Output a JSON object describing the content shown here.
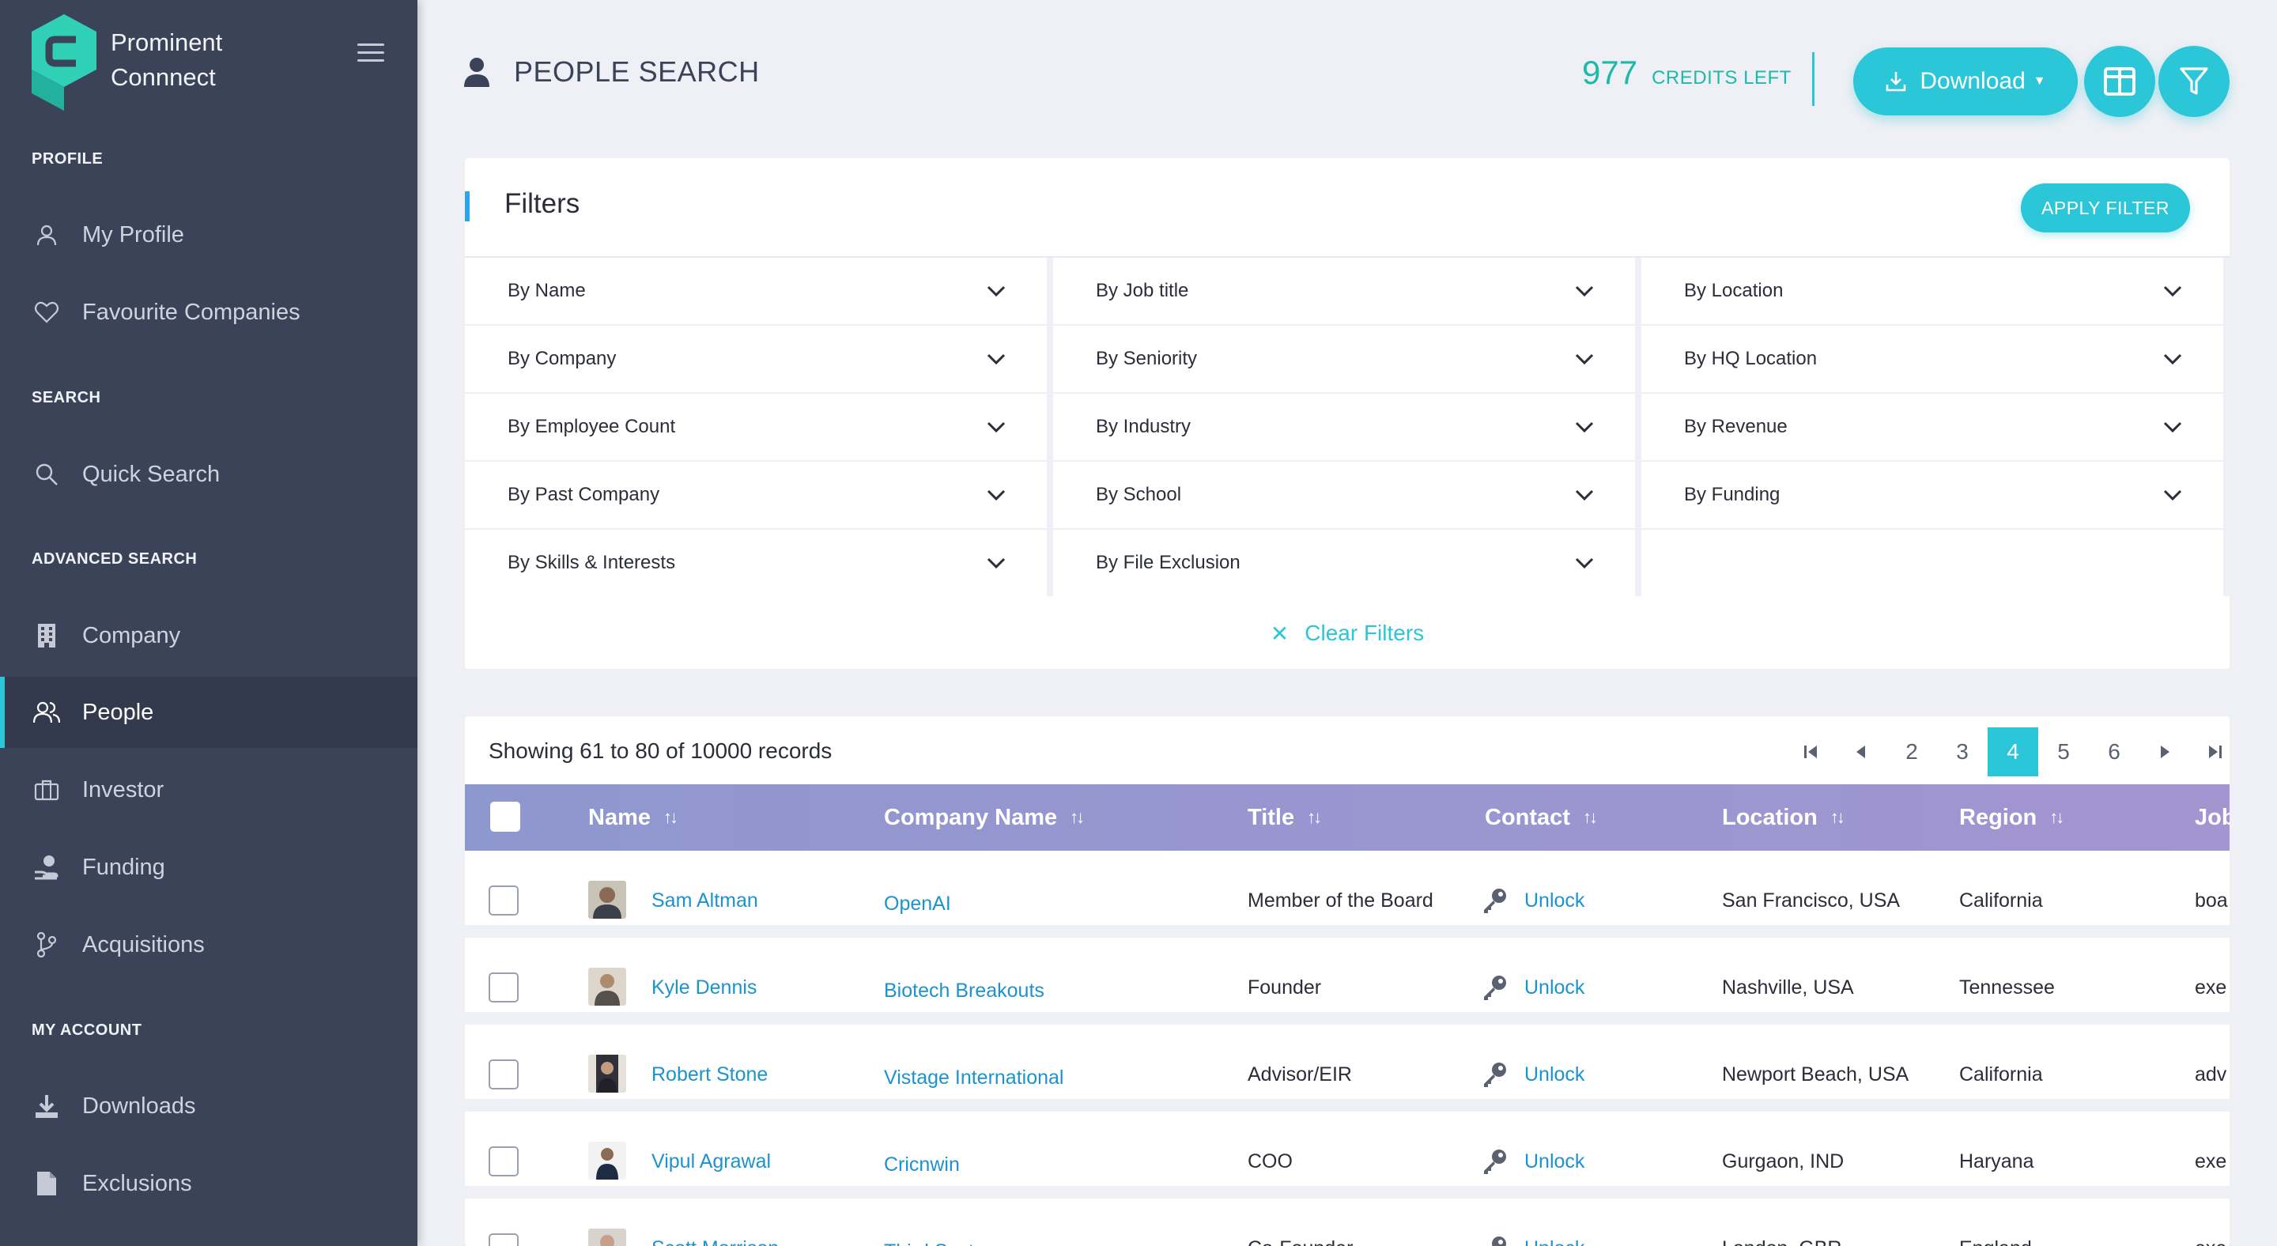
{
  "brand": {
    "name": "Prominent\nConnnect"
  },
  "sidebar": {
    "sections": [
      {
        "label": "PROFILE"
      },
      {
        "label": "SEARCH"
      },
      {
        "label": "ADVANCED SEARCH"
      },
      {
        "label": "MY ACCOUNT"
      }
    ],
    "items": [
      {
        "label": "My Profile",
        "icon": "user-icon",
        "active": false
      },
      {
        "label": "Favourite Companies",
        "icon": "heart-icon",
        "active": false
      },
      {
        "label": "Quick Search",
        "icon": "search-icon",
        "active": false
      },
      {
        "label": "Company",
        "icon": "building-icon",
        "active": false
      },
      {
        "label": "People",
        "icon": "people-icon",
        "active": true
      },
      {
        "label": "Investor",
        "icon": "briefcase-icon",
        "active": false
      },
      {
        "label": "Funding",
        "icon": "hand-coin-icon",
        "active": false
      },
      {
        "label": "Acquisitions",
        "icon": "branch-icon",
        "active": false
      },
      {
        "label": "Downloads",
        "icon": "download-icon",
        "active": false
      },
      {
        "label": "Exclusions",
        "icon": "file-icon",
        "active": false
      }
    ]
  },
  "header": {
    "title": "PEOPLE SEARCH",
    "credits_value": "977",
    "credits_label": "CREDITS LEFT",
    "download_label": "Download"
  },
  "filters": {
    "title": "Filters",
    "apply_label": "APPLY FILTER",
    "clear_label": "Clear Filters",
    "items": [
      "By Name",
      "By Job title",
      "By Location",
      "By Company",
      "By Seniority",
      "By HQ Location",
      "By Employee Count",
      "By Industry",
      "By Revenue",
      "By Past Company",
      "By School",
      "By Funding",
      "By Skills & Interests",
      "By File Exclusion"
    ]
  },
  "results": {
    "summary": "Showing 61 to 80 of 10000 records",
    "pages": [
      "2",
      "3",
      "4",
      "5",
      "6"
    ],
    "current_page": "4",
    "columns": [
      "Name",
      "Company Name",
      "Title",
      "Contact",
      "Location",
      "Region",
      "Job"
    ],
    "unlock_label": "Unlock",
    "rows": [
      {
        "name": "Sam Altman",
        "company": "OpenAI",
        "title": "Member of the Board",
        "location": "San Francisco, USA",
        "region": "California",
        "job": "boa"
      },
      {
        "name": "Kyle Dennis",
        "company": "Biotech Breakouts",
        "title": "Founder",
        "location": "Nashville, USA",
        "region": "Tennessee",
        "job": "exe"
      },
      {
        "name": "Robert Stone",
        "company": "Vistage International",
        "title": "Advisor/EIR",
        "location": "Newport Beach, USA",
        "region": "California",
        "job": "adv"
      },
      {
        "name": "Vipul Agrawal",
        "company": "Cricnwin",
        "title": "COO",
        "location": "Gurgaon, IND",
        "region": "Haryana",
        "job": "exe"
      },
      {
        "name": "Scott Morrison",
        "company": "Third Sector",
        "title": "Co-Founder",
        "location": "London, GBR",
        "region": "England",
        "job": "exe"
      }
    ]
  },
  "colors": {
    "accent": "#2bc6d8",
    "sidebar": "#3b4358",
    "link": "#1b93cf",
    "table_header": "#9a96d0",
    "credits": "#1fb9a9"
  }
}
